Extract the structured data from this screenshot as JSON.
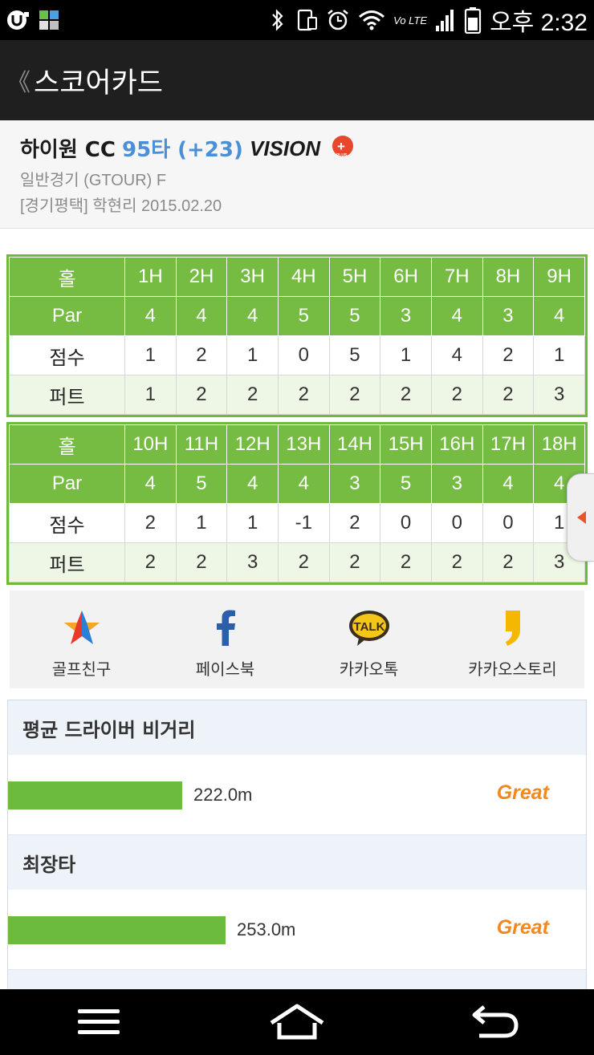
{
  "status_bar": {
    "time": "오후 2:32",
    "network_label": "Vo LTE",
    "left_icons": [
      "u-app-icon",
      "grid-app-icon"
    ],
    "right_icons": [
      "bluetooth-icon",
      "phone-icon",
      "alarm-icon",
      "wifi-icon",
      "volte-icon",
      "signal-icon",
      "battery-icon"
    ]
  },
  "action_bar": {
    "back": "《",
    "title": "스코어카드"
  },
  "header": {
    "course": "하이원 CC",
    "score": "95타 (+23)",
    "brand": "VISION",
    "brand_badge": "PLUS",
    "game_type": "일반경기 (GTOUR) F",
    "location_date": "[경기평택] 학현리 2015.02.20"
  },
  "front_nine": {
    "labels": {
      "hole": "홀",
      "par": "Par",
      "score": "점수",
      "putt": "퍼트"
    },
    "holes": [
      "1H",
      "2H",
      "3H",
      "4H",
      "5H",
      "6H",
      "7H",
      "8H",
      "9H"
    ],
    "par": [
      "4",
      "4",
      "4",
      "5",
      "5",
      "3",
      "4",
      "3",
      "4"
    ],
    "score": [
      "1",
      "2",
      "1",
      "0",
      "5",
      "1",
      "4",
      "2",
      "1"
    ],
    "putt": [
      "1",
      "2",
      "2",
      "2",
      "2",
      "2",
      "2",
      "2",
      "3"
    ]
  },
  "back_nine": {
    "labels": {
      "hole": "홀",
      "par": "Par",
      "score": "점수",
      "putt": "퍼트"
    },
    "holes": [
      "10H",
      "11H",
      "12H",
      "13H",
      "14H",
      "15H",
      "16H",
      "17H",
      "18H"
    ],
    "par": [
      "4",
      "5",
      "4",
      "4",
      "3",
      "5",
      "3",
      "4",
      "4"
    ],
    "score": [
      "2",
      "1",
      "1",
      "-1",
      "2",
      "0",
      "0",
      "0",
      "1"
    ],
    "putt": [
      "2",
      "2",
      "3",
      "2",
      "2",
      "2",
      "2",
      "2",
      "3"
    ]
  },
  "share": [
    {
      "label": "골프친구",
      "icon": "star-icon"
    },
    {
      "label": "페이스북",
      "icon": "facebook-icon"
    },
    {
      "label": "카카오톡",
      "icon": "kakaotalk-icon",
      "icon_text": "TALK"
    },
    {
      "label": "카카오스토리",
      "icon": "kakaostory-icon"
    }
  ],
  "stats": [
    {
      "title": "평균 드라이버 비거리",
      "value": "222.0m",
      "grade": "Great",
      "bar_fraction": 0.3
    },
    {
      "title": "최장타",
      "value": "253.0m",
      "grade": "Great",
      "bar_fraction": 0.375
    }
  ],
  "colors": {
    "table_green": "#76bc43",
    "table_light": "#eef7e6",
    "score_blue": "#4a90d9",
    "grade_orange": "#f08a1f",
    "bar_green": "#6cbb3c"
  },
  "nav_bar": {
    "buttons": [
      "menu-icon",
      "home-icon",
      "back-icon"
    ]
  }
}
